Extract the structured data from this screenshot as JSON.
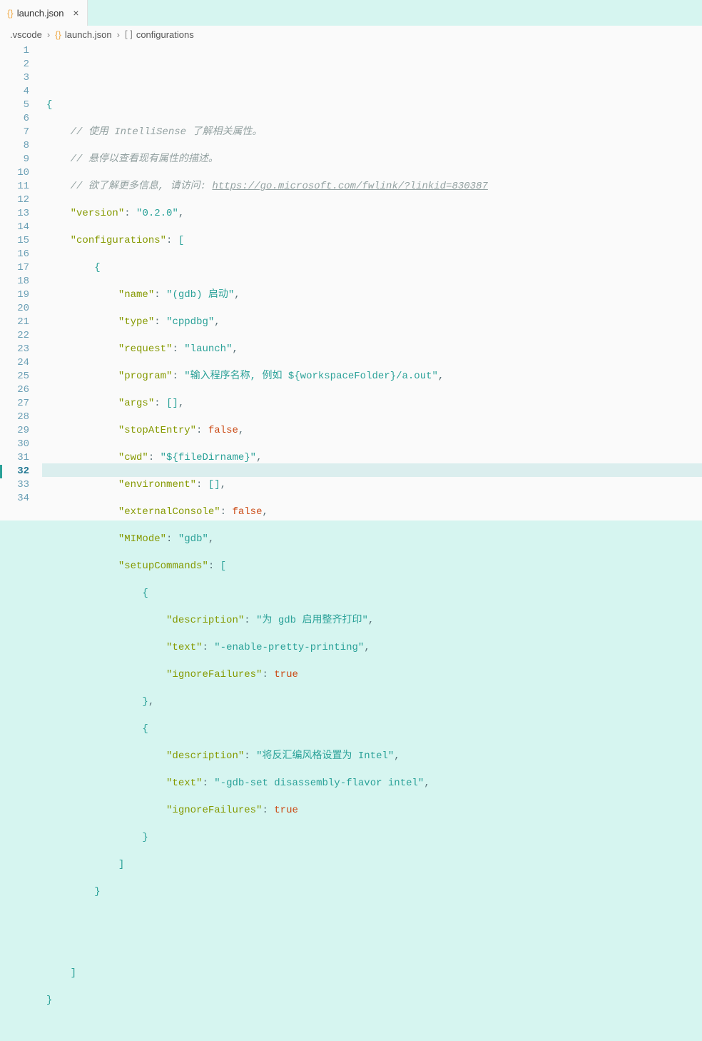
{
  "tab": {
    "filename": "launch.json",
    "icon": "{}"
  },
  "breadcrumb": {
    "seg0": ".vscode",
    "seg1": "launch.json",
    "seg2": "configurations",
    "bracket_icon": "[ ]"
  },
  "lineNumbers": [
    "1",
    "2",
    "3",
    "4",
    "5",
    "6",
    "7",
    "8",
    "9",
    "10",
    "11",
    "12",
    "13",
    "14",
    "15",
    "16",
    "17",
    "18",
    "19",
    "20",
    "21",
    "22",
    "23",
    "24",
    "25",
    "26",
    "27",
    "28",
    "29",
    "30",
    "31",
    "32",
    "33",
    "34"
  ],
  "currentLine": 32,
  "comments": {
    "l2": "// 使用 IntelliSense 了解相关属性。",
    "l3": "// 悬停以查看现有属性的描述。",
    "l4a": "// 欲了解更多信息, 请访问: ",
    "l4url": "https://go.microsoft.com/fwlink/?linkid=830387"
  },
  "keys": {
    "version": "\"version\"",
    "configurations": "\"configurations\"",
    "name": "\"name\"",
    "type": "\"type\"",
    "request": "\"request\"",
    "program": "\"program\"",
    "args": "\"args\"",
    "stopAtEntry": "\"stopAtEntry\"",
    "cwd": "\"cwd\"",
    "environment": "\"environment\"",
    "externalConsole": "\"externalConsole\"",
    "MIMode": "\"MIMode\"",
    "setupCommands": "\"setupCommands\"",
    "description": "\"description\"",
    "text": "\"text\"",
    "ignoreFailures": "\"ignoreFailures\""
  },
  "vals": {
    "version": "\"0.2.0\"",
    "name": "\"(gdb) 启动\"",
    "type": "\"cppdbg\"",
    "request": "\"launch\"",
    "program": "\"输入程序名称, 例如 ${workspaceFolder}/a.out\"",
    "cwd": "\"${fileDirname}\"",
    "MIMode": "\"gdb\"",
    "desc1": "\"为 gdb 启用整齐打印\"",
    "text1": "\"-enable-pretty-printing\"",
    "desc2": "\"将反汇编风格设置为 Intel\"",
    "text2": "\"-gdb-set disassembly-flavor intel\"",
    "false": "false",
    "true": "true",
    "emptyArr": "[]"
  },
  "punct": {
    "colon": ":",
    "comma": ",",
    "ob": "{",
    "cb": "}",
    "osb": "[",
    "csb": "]"
  }
}
